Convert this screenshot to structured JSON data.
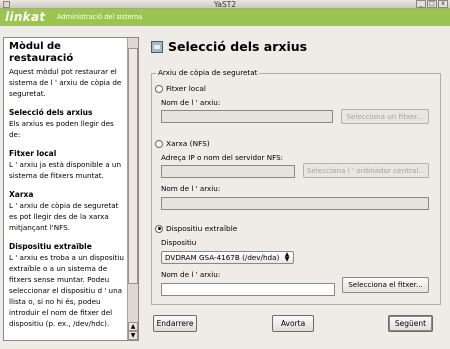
{
  "window": {
    "title": "YaST2",
    "btn_min": "_",
    "btn_max": "□",
    "btn_close": "x"
  },
  "banner": {
    "logo": "linkat",
    "subtitle": "Administració del sistema",
    "color": "#9ac54f"
  },
  "help": {
    "title": "Mòdul de restauració",
    "intro": "Aquest mòdul pot restaurar el sistema de l ' arxiu de còpia de seguretat.",
    "s1_title": "Selecció dels arxius",
    "s1_text": "Els arxius es poden llegir des de:",
    "s2_title": "Fitxer local",
    "s2_text": "L ' arxiu ja està disponible a un sistema de fitxers muntat.",
    "s3_title": "Xarxa",
    "s3_text": "L ' arxiu de còpia de seguretat es pot llegir des de la xarxa mitjançant l'NFS.",
    "s4_title": "Dispositiu extraïble",
    "s4_text": "L ' arxiu es troba a un dispositiu extraïble o a un sistema de fitxers sense muntar. Podeu seleccionar el dispositiu d ' una llista o, si no hi és, podeu introduir el nom de fitxer del dispositiu (p. ex., /dev/hdc)."
  },
  "main": {
    "heading": "Selecció dels arxius",
    "frame_label": "Arxiu de còpia de seguretat",
    "local": {
      "label": "Fitxer local",
      "name_label": "Nom de l ' arxiu:",
      "value": "",
      "button": "Selecciona un fitxer..."
    },
    "network": {
      "label": "Xarxa (NFS)",
      "server_label": "Adreça IP o nom del servidor NFS:",
      "server_value": "",
      "server_button": "Selecciona l ' ordinador central...",
      "name_label": "Nom de l ' arxiu:",
      "value": ""
    },
    "removable": {
      "label": "Dispositiu extraïble",
      "device_label": "Dispositiu",
      "device_value": "DVDRAM GSA-4167B (/dev/hda)",
      "name_label": "Nom de l ' arxiu:",
      "value": "",
      "button": "Selecciona el fitxer..."
    }
  },
  "buttons": {
    "back": "Endarrere",
    "abort": "Avorta",
    "next": "Següent"
  }
}
